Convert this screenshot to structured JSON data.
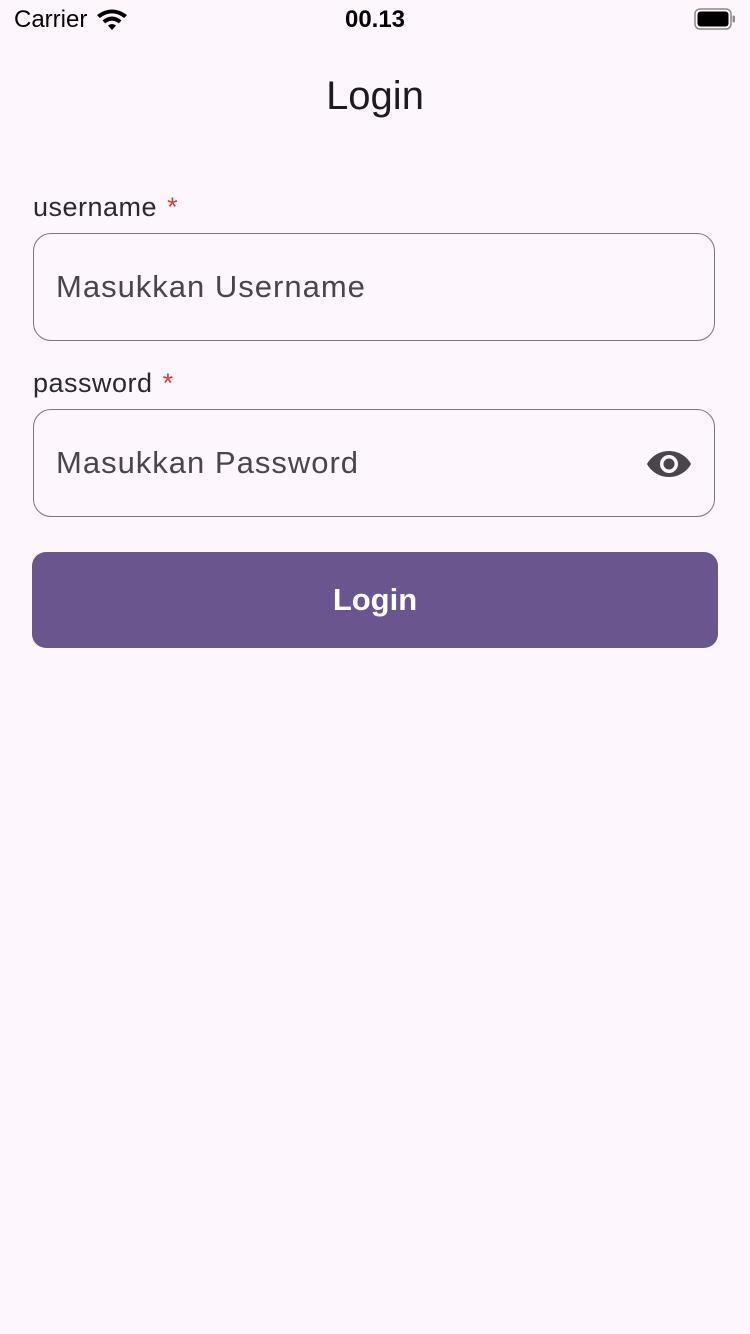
{
  "status_bar": {
    "carrier": "Carrier",
    "time": "00.13",
    "wifi_icon": "wifi-icon",
    "battery_icon": "battery-full-icon"
  },
  "header": {
    "title": "Login"
  },
  "form": {
    "username": {
      "label": "username",
      "required_mark": "*",
      "placeholder": "Masukkan Username",
      "value": ""
    },
    "password": {
      "label": "password",
      "required_mark": "*",
      "placeholder": "Masukkan Password",
      "value": "",
      "toggle_icon": "eye-icon"
    },
    "submit_label": "Login"
  },
  "colors": {
    "background": "#fdf7fd",
    "primary": "#6a558f",
    "required": "#e53935",
    "outline": "#79747e"
  }
}
